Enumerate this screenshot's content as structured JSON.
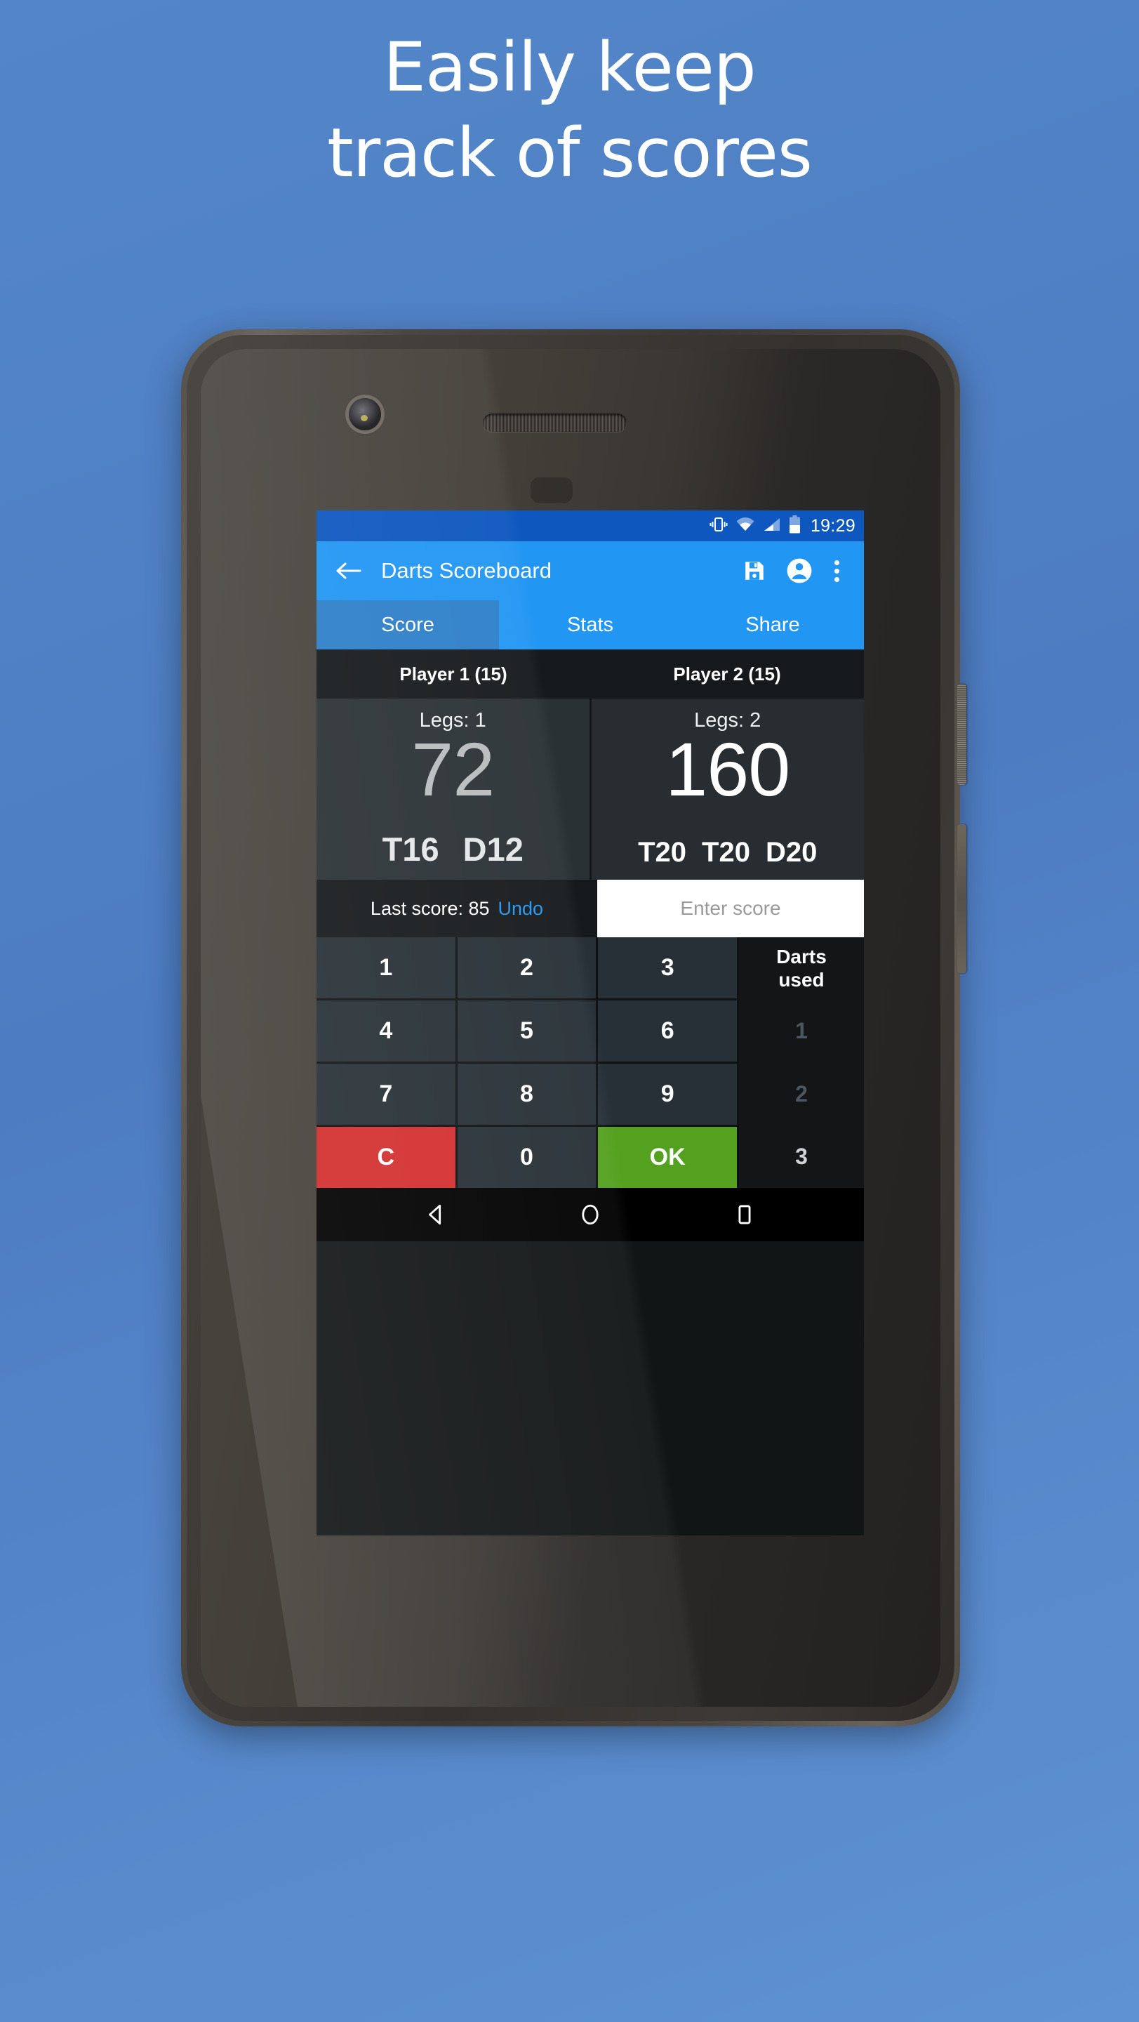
{
  "promo": {
    "headline_line1": "Easily keep",
    "headline_line2": "track of scores",
    "background_color": "#4e7fc4"
  },
  "status_bar": {
    "time": "19:29",
    "icons": [
      "vibrate-icon",
      "wifi-icon",
      "signal-icon",
      "battery-icon"
    ],
    "background_color": "#0d57bf"
  },
  "app_bar": {
    "title": "Darts Scoreboard",
    "back_icon": "back-arrow-icon",
    "save_icon": "save-icon",
    "account_icon": "account-icon",
    "overflow_icon": "overflow-menu-icon",
    "background_color": "#2196f3"
  },
  "tabs": [
    {
      "label": "Score",
      "selected": true
    },
    {
      "label": "Stats",
      "selected": false
    },
    {
      "label": "Share",
      "selected": false
    }
  ],
  "players": [
    {
      "header": "Player 1 (15)",
      "legs_label": "Legs: 1",
      "score": "72",
      "checkout": [
        "T16",
        "D12"
      ]
    },
    {
      "header": "Player 2 (15)",
      "legs_label": "Legs: 2",
      "score": "160",
      "checkout": [
        "T20",
        "T20",
        "D20"
      ]
    }
  ],
  "score_entry": {
    "last_score_label": "Last score: 85",
    "undo_label": "Undo",
    "input_placeholder": "Enter score",
    "input_value": ""
  },
  "keypad": {
    "keys": [
      {
        "label": "1",
        "type": "digit"
      },
      {
        "label": "2",
        "type": "digit"
      },
      {
        "label": "3",
        "type": "digit"
      },
      {
        "label": "4",
        "type": "digit"
      },
      {
        "label": "5",
        "type": "digit"
      },
      {
        "label": "6",
        "type": "digit"
      },
      {
        "label": "7",
        "type": "digit"
      },
      {
        "label": "8",
        "type": "digit"
      },
      {
        "label": "9",
        "type": "digit"
      },
      {
        "label": "C",
        "type": "clear"
      },
      {
        "label": "0",
        "type": "digit"
      },
      {
        "label": "OK",
        "type": "ok"
      }
    ],
    "clear_color": "#d32f2f",
    "ok_color": "#54a11f"
  },
  "darts_used": {
    "title_line1": "Darts",
    "title_line2": "used",
    "options": [
      "1",
      "2",
      "3"
    ],
    "selected": "3"
  },
  "nav_bar": {
    "back_icon": "nav-back-icon",
    "home_icon": "nav-home-icon",
    "recents_icon": "nav-recents-icon"
  }
}
